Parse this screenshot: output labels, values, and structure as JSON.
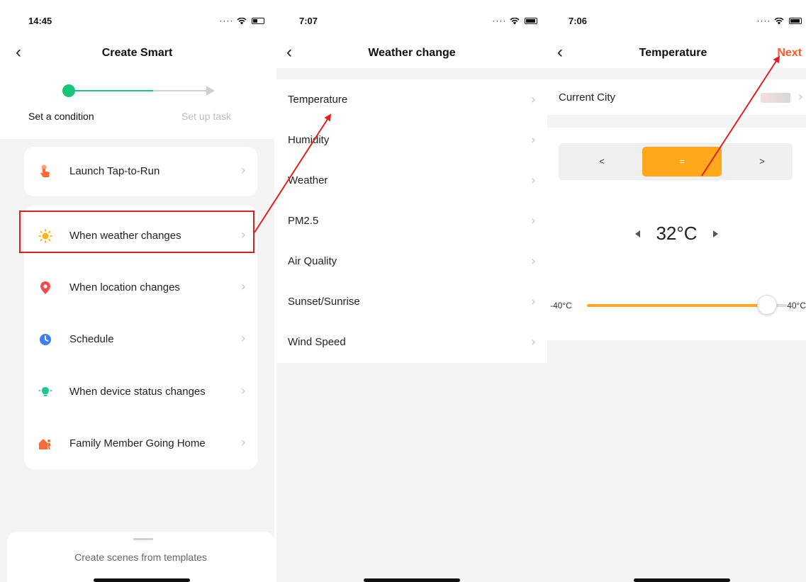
{
  "screen1": {
    "status_time": "14:45",
    "nav_title": "Create Smart",
    "steps": [
      "Set a condition",
      "Set up task"
    ],
    "tap_to_run": "Launch Tap-to-Run",
    "conditions": [
      {
        "label": "When weather changes",
        "icon": "sun-icon",
        "color": "#ffb31a"
      },
      {
        "label": "When location changes",
        "icon": "location-pin-icon",
        "color": "#f24d4d"
      },
      {
        "label": "Schedule",
        "icon": "clock-icon",
        "color": "#3d7ff2"
      },
      {
        "label": "When device status changes",
        "icon": "bulb-icon",
        "color": "#1fc98c"
      },
      {
        "label": "Family Member Going Home",
        "icon": "person-home-icon",
        "color": "#f76b3a"
      }
    ],
    "sheet_label": "Create scenes from templates"
  },
  "screen2": {
    "status_time": "7:07",
    "nav_title": "Weather change",
    "items": [
      "Temperature",
      "Humidity",
      "Weather",
      "PM2.5",
      "Air Quality",
      "Sunset/Sunrise",
      "Wind Speed"
    ]
  },
  "screen3": {
    "status_time": "7:06",
    "nav_title": "Temperature",
    "next_label": "Next",
    "city_label": "Current City",
    "comparators": [
      "<",
      "=",
      ">"
    ],
    "selected_comparator": "=",
    "temperature": "32°C",
    "slider_min": "-40°C",
    "slider_max": "40°C",
    "slider_value": 32,
    "slider_range": [
      -40,
      40
    ]
  },
  "colors": {
    "accent_green": "#1bc47d",
    "accent_orange": "#ffa81c",
    "next_red": "#ff5a2c",
    "highlight_red": "#e02020"
  }
}
